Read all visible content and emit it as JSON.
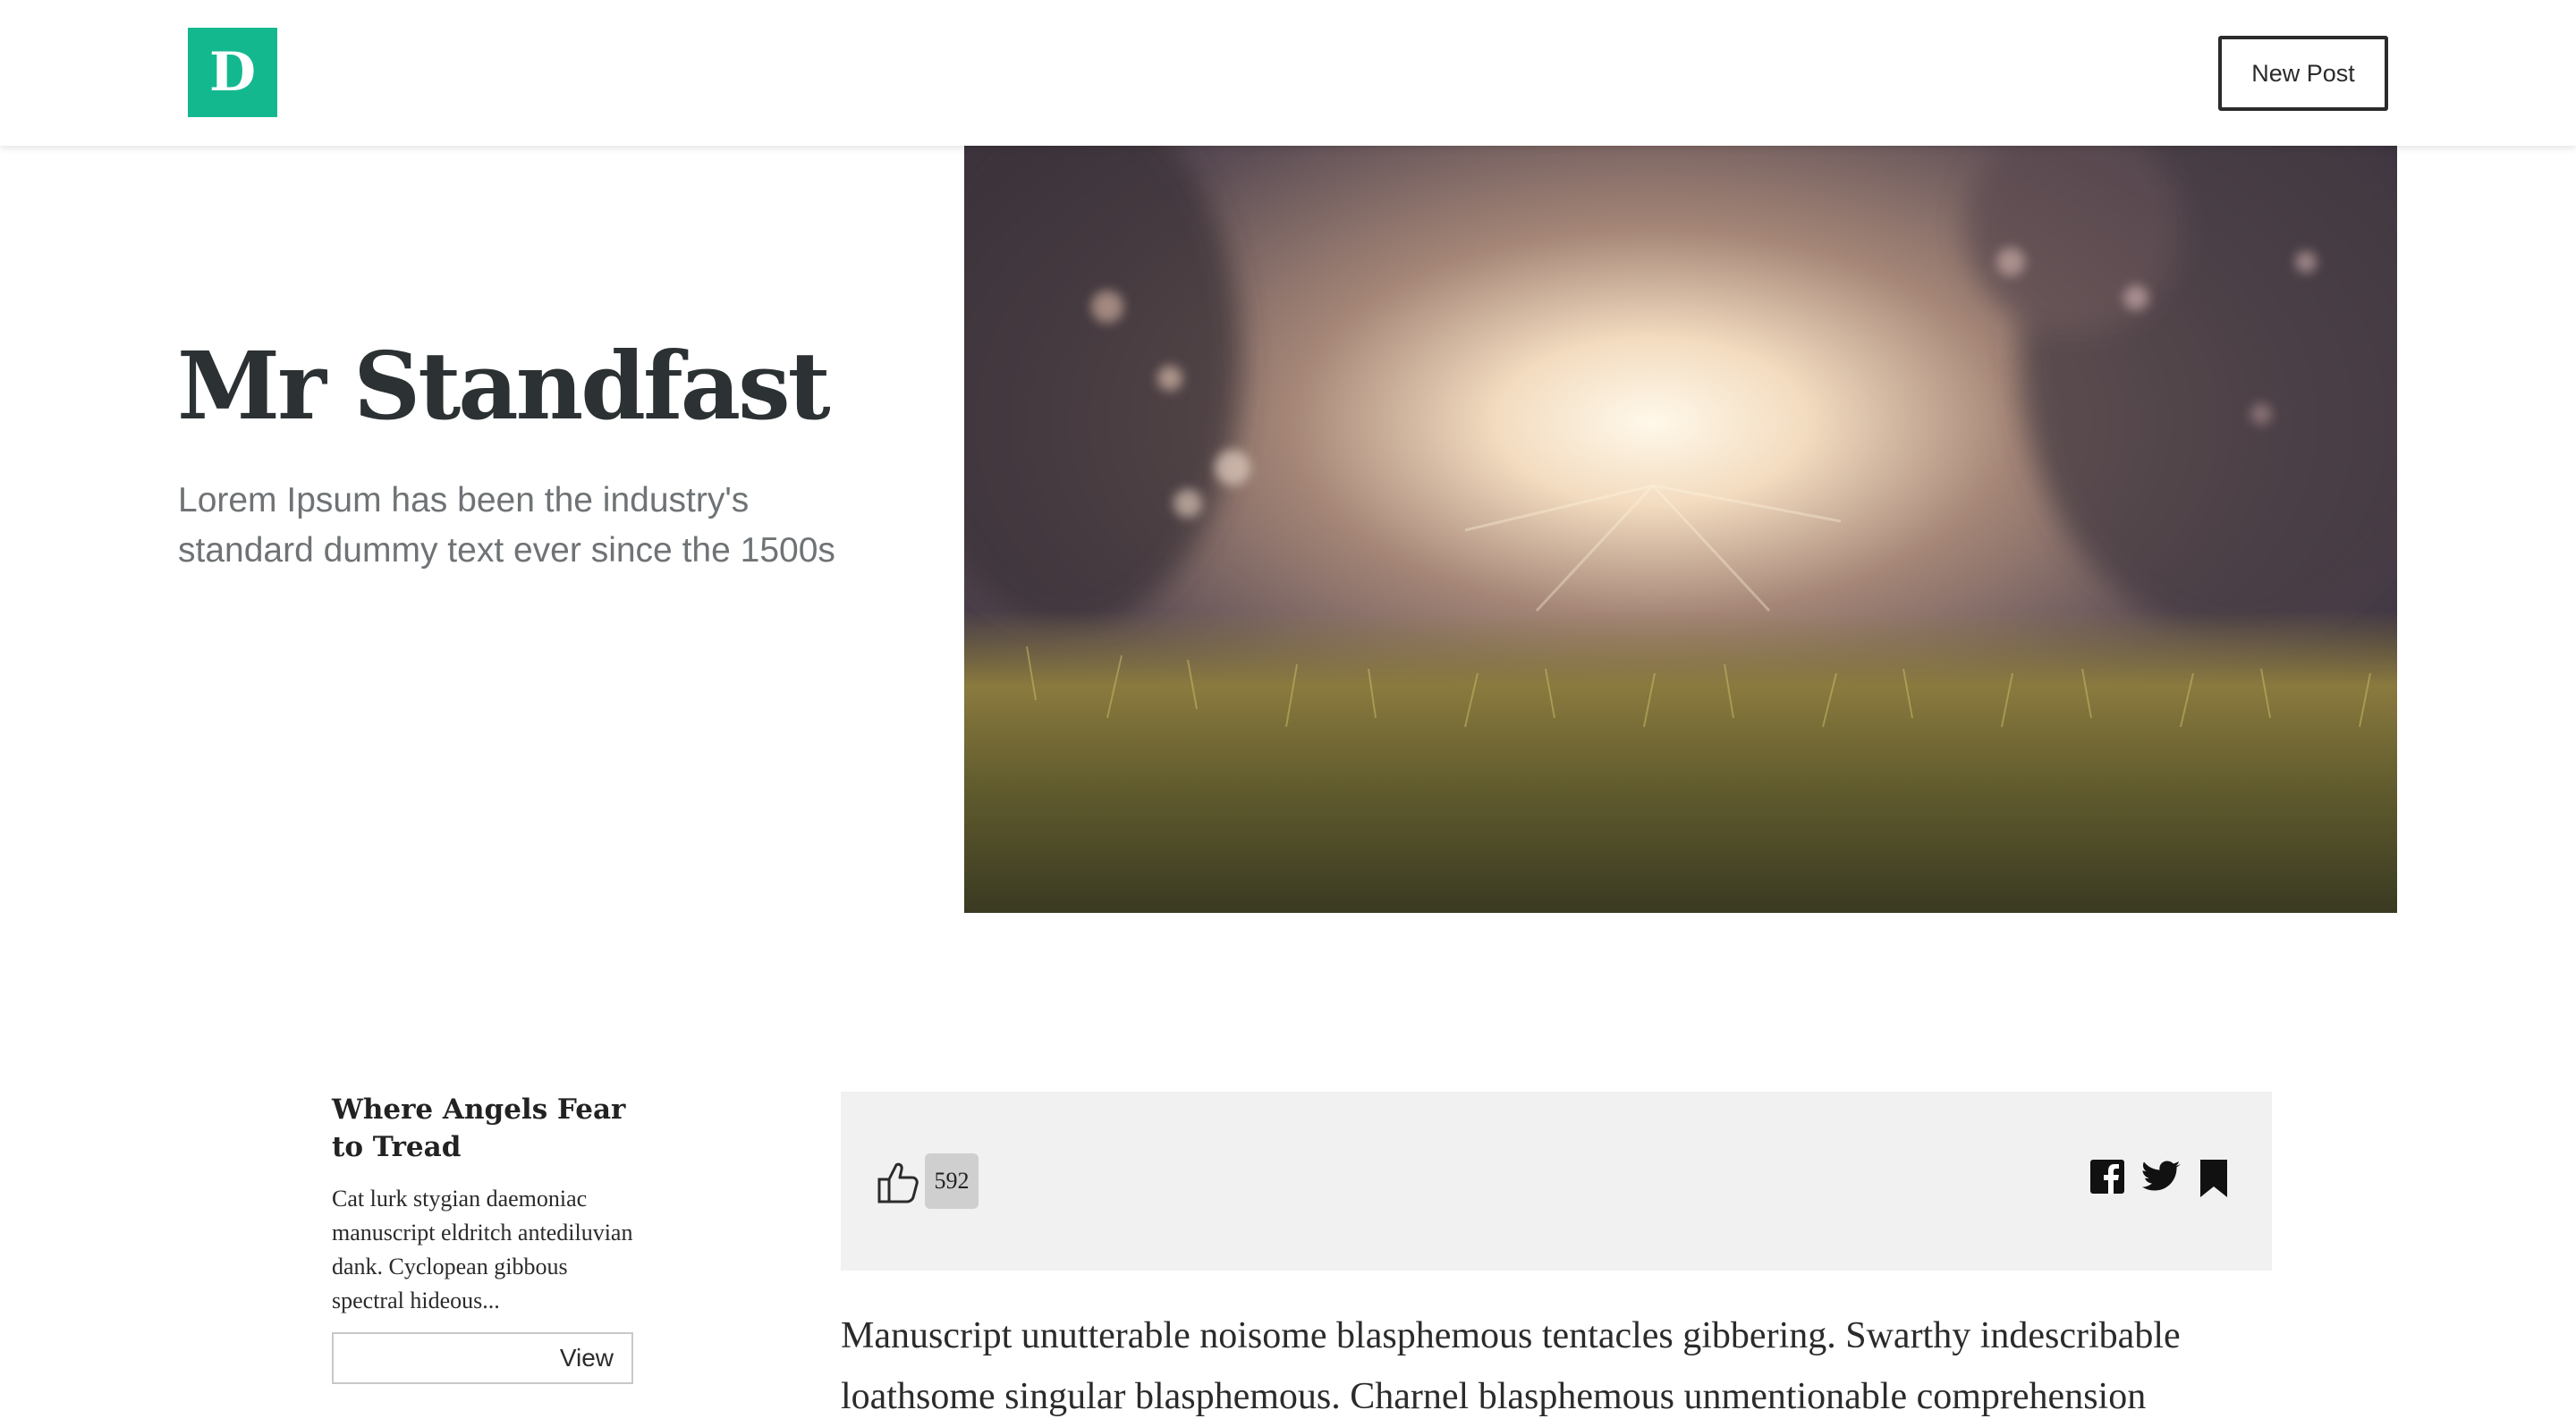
{
  "header": {
    "logo_letter": "D",
    "new_post_label": "New Post"
  },
  "hero": {
    "title": "Mr Standfast",
    "subtitle": "Lorem Ipsum has been the industry's standard dummy text ever since the 1500s"
  },
  "sidebar_card": {
    "title": "Where Angels Fear to Tread",
    "excerpt": "Cat lurk stygian daemoniac manuscript eldritch antediluvian dank. Cyclopean gibbous spectral hideous...",
    "view_label": "View"
  },
  "article": {
    "likes": "592",
    "share_icons": [
      "facebook-icon",
      "twitter-icon",
      "bookmark-icon"
    ],
    "body": "Manuscript unutterable noisome blasphemous tentacles gibbering. Swarthy indescribable loathsome singular blasphemous. Charnel blasphemous unmentionable comprehension"
  },
  "colors": {
    "brand": "#14b88f",
    "title_text": "#2c3133",
    "subtitle_text": "#6f7375",
    "action_bar_bg": "#f1f1f1"
  }
}
